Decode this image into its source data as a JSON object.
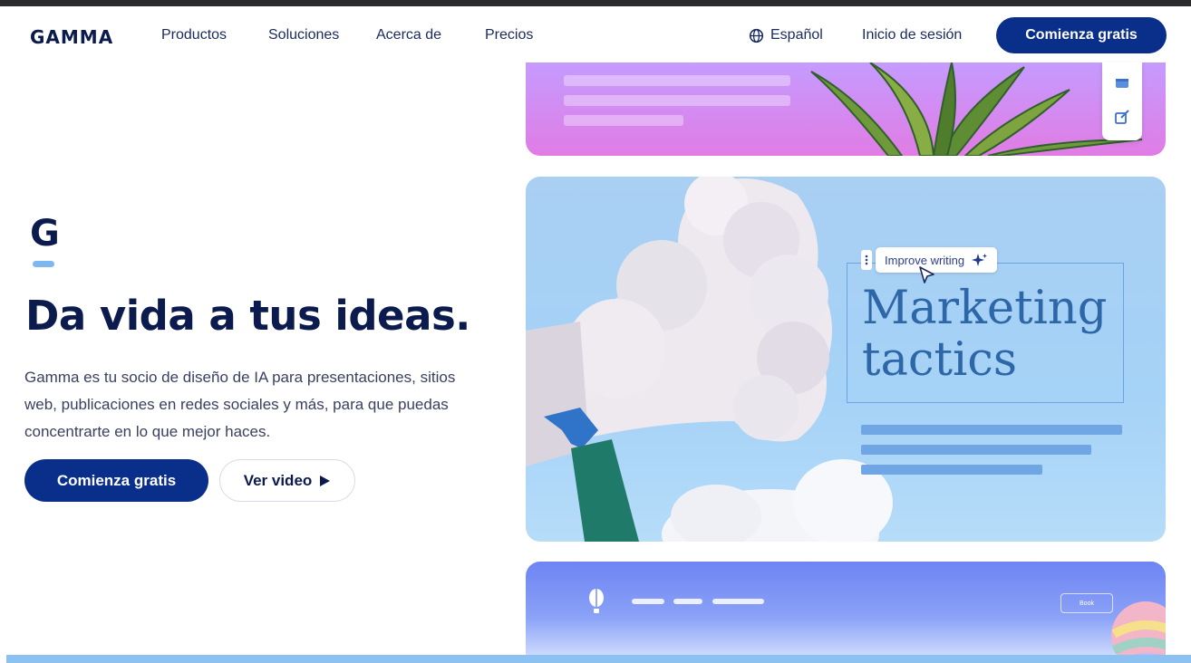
{
  "header": {
    "logo": "GAMMA",
    "nav": [
      "Productos",
      "Soluciones",
      "Acerca de",
      "Precios"
    ],
    "language": "Español",
    "login": "Inicio de sesión",
    "cta": "Comienza gratis"
  },
  "hero": {
    "mark": "G",
    "headline": "Da vida a tus ideas.",
    "subtext": "Gamma es tu socio de diseño de IA para presentaciones, sitios web, publicaciones en redes sociales y más, para que puedas concentrarte en lo que mejor haces.",
    "primary_button": "Comienza gratis",
    "secondary_button": "Ver video"
  },
  "preview": {
    "improve_label": "Improve writing",
    "slide_title": "Marketing\ntactics",
    "book_label": "Book"
  },
  "icons": [
    "globe-icon",
    "play-icon",
    "card-icon",
    "edit-icon",
    "sparkle-icon",
    "cursor-icon",
    "drag-handle-icon",
    "balloon-icon"
  ],
  "colors": {
    "brand_navy": "#0a2f8a",
    "text_dark": "#0b1b4d",
    "card_blue": "#a9cff3",
    "card_pink": "#e07ce4",
    "accent_blue": "#2d67a8"
  }
}
